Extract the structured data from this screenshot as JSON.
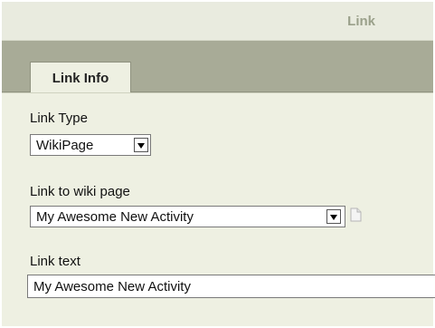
{
  "dialog": {
    "title": "Link"
  },
  "tabs": [
    {
      "label": "Link Info",
      "active": true
    }
  ],
  "form": {
    "link_type": {
      "label": "Link Type",
      "selected": "WikiPage"
    },
    "wiki_page": {
      "label": "Link to wiki page",
      "selected": "My Awesome New Activity",
      "icon": "document-icon"
    },
    "link_text": {
      "label": "Link text",
      "value": "My Awesome New Activity"
    }
  },
  "colors": {
    "dialog_bg": "#eef0e2",
    "tabstrip_bg": "#a8ab97",
    "title_text": "#9aa08a"
  }
}
